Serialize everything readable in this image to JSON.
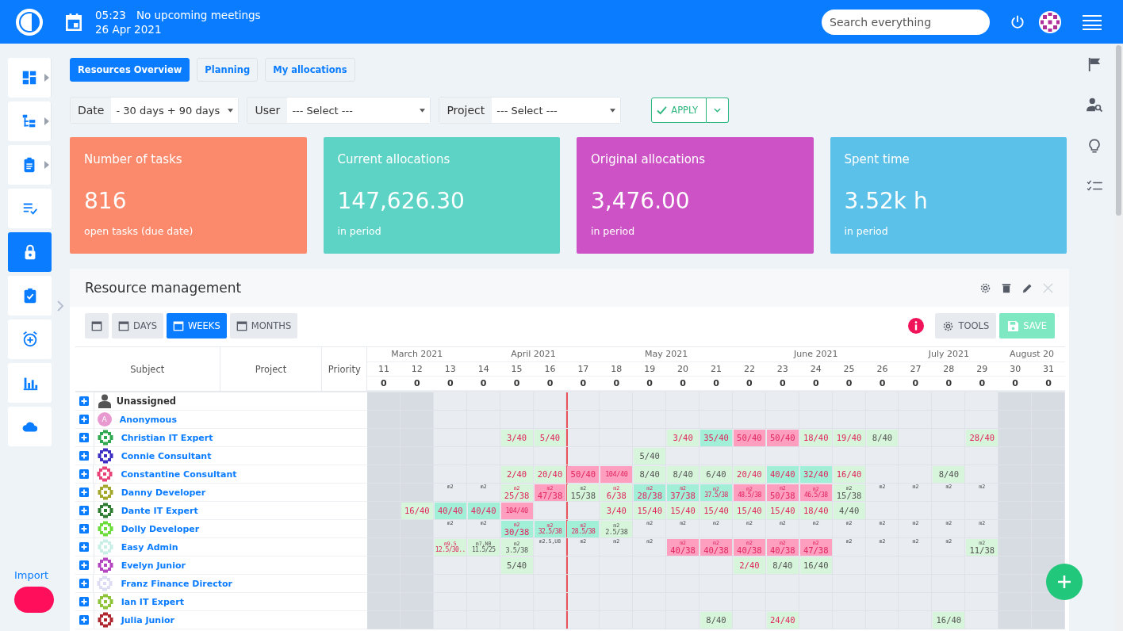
{
  "header": {
    "time": "05:23",
    "meetings": "No upcoming meetings",
    "date": "26 Apr 2021",
    "search": {
      "placeholder": "Search everything"
    }
  },
  "sidebar": {
    "items": [
      {
        "selected": false,
        "submenu": true
      },
      {
        "selected": false,
        "submenu": true
      },
      {
        "selected": false,
        "submenu": true
      },
      {
        "selected": false,
        "submenu": false
      },
      {
        "selected": true,
        "submenu": false
      },
      {
        "selected": false,
        "submenu": false
      },
      {
        "selected": false,
        "submenu": false
      },
      {
        "selected": false,
        "submenu": false
      },
      {
        "selected": false,
        "submenu": false
      }
    ],
    "import_label": "Import"
  },
  "tabs": [
    {
      "label": "Resources Overview",
      "selected": true
    },
    {
      "label": "Planning",
      "selected": false
    },
    {
      "label": "My allocations",
      "selected": false
    }
  ],
  "filters": [
    {
      "label": "Date",
      "value": "- 30 days + 90 days"
    },
    {
      "label": "User",
      "value": "--- Select ---"
    },
    {
      "label": "Project",
      "value": "--- Select ---"
    }
  ],
  "apply_button": "APPLY",
  "cards": [
    {
      "title": "Number of tasks",
      "value": "816",
      "caption": "open tasks (due date)",
      "color": "#fb8a6c"
    },
    {
      "title": "Current allocations",
      "value": "147,626.30",
      "caption": "in period",
      "color": "#5dd3c6"
    },
    {
      "title": "Original allocations",
      "value": "3,476.00",
      "caption": "in period",
      "color": "#cc52c6"
    },
    {
      "title": "Spent time",
      "value": "3.52k h",
      "caption": "in period",
      "color": "#5cc1e8"
    }
  ],
  "widget": {
    "title": "Resource management",
    "view_buttons": [
      {
        "label": "DAYS",
        "selected": false
      },
      {
        "label": "WEEKS",
        "selected": true
      },
      {
        "label": "MONTHS",
        "selected": false
      }
    ],
    "tools_button": "TOOLS",
    "save_button": "SAVE",
    "columns": [
      "Subject",
      "Project",
      "Priority"
    ],
    "months": [
      "March 2021",
      "April 2021",
      "May 2021",
      "June 2021",
      "July 2021",
      "August 20"
    ],
    "weeks": [
      {
        "label": "11",
        "count": "0",
        "shaded": true,
        "today": false
      },
      {
        "label": "12",
        "count": "0",
        "shaded": true,
        "today": false
      },
      {
        "label": "13",
        "count": "0",
        "shaded": false,
        "today": false
      },
      {
        "label": "14",
        "count": "0",
        "shaded": false,
        "today": false
      },
      {
        "label": "15",
        "count": "0",
        "shaded": false,
        "today": false
      },
      {
        "label": "16",
        "count": "0",
        "shaded": false,
        "today": false
      },
      {
        "label": "17",
        "count": "0",
        "shaded": false,
        "today": true
      },
      {
        "label": "18",
        "count": "0",
        "shaded": false,
        "today": false
      },
      {
        "label": "19",
        "count": "0",
        "shaded": false,
        "today": false
      },
      {
        "label": "20",
        "count": "0",
        "shaded": false,
        "today": false
      },
      {
        "label": "21",
        "count": "0",
        "shaded": false,
        "today": false
      },
      {
        "label": "22",
        "count": "0",
        "shaded": false,
        "today": false
      },
      {
        "label": "23",
        "count": "0",
        "shaded": false,
        "today": false
      },
      {
        "label": "24",
        "count": "0",
        "shaded": false,
        "today": false
      },
      {
        "label": "25",
        "count": "0",
        "shaded": false,
        "today": false
      },
      {
        "label": "26",
        "count": "0",
        "shaded": false,
        "today": false
      },
      {
        "label": "27",
        "count": "0",
        "shaded": false,
        "today": false
      },
      {
        "label": "28",
        "count": "0",
        "shaded": false,
        "today": false
      },
      {
        "label": "29",
        "count": "0",
        "shaded": false,
        "today": false
      },
      {
        "label": "30",
        "count": "0",
        "shaded": true,
        "today": false
      },
      {
        "label": "31",
        "count": "0",
        "shaded": true,
        "today": false
      }
    ],
    "rows": [
      {
        "name": "Unassigned",
        "kind": "group"
      },
      {
        "name": "Anonymous",
        "kind": "user",
        "initial": "A",
        "color": "#e89ad0"
      },
      {
        "name": "Christian IT Expert",
        "kind": "user",
        "color": "#2fa84f",
        "cells": [
          {
            "kind": "empty"
          },
          {
            "kind": "empty"
          },
          {
            "kind": "empty"
          },
          {
            "kind": "empty"
          },
          {
            "value": "3/40",
            "kind": "partial"
          },
          {
            "value": "5/40",
            "kind": "partial"
          },
          {
            "kind": "empty"
          },
          {
            "kind": "empty"
          },
          {
            "kind": "empty"
          },
          {
            "value": "3/40",
            "kind": "partial"
          },
          {
            "value": "35/40",
            "kind": "full"
          },
          {
            "value": "50/40",
            "kind": "over"
          },
          {
            "value": "50/40",
            "kind": "over"
          },
          {
            "value": "18/40",
            "kind": "partial"
          },
          {
            "value": "19/40",
            "kind": "partial"
          },
          {
            "value": "8/40",
            "kind": "low"
          },
          {
            "kind": "empty"
          },
          {
            "kind": "empty"
          },
          {
            "value": "28/40",
            "kind": "partial"
          },
          {
            "kind": "empty"
          },
          {
            "kind": "empty"
          }
        ]
      },
      {
        "name": "Connie Consultant",
        "kind": "user",
        "color": "#3d2fc4",
        "cells": [
          {
            "kind": "empty"
          },
          {
            "kind": "empty"
          },
          {
            "kind": "empty"
          },
          {
            "kind": "empty"
          },
          {
            "kind": "empty"
          },
          {
            "kind": "empty"
          },
          {
            "kind": "empty"
          },
          {
            "kind": "empty"
          },
          {
            "value": "5/40",
            "kind": "low"
          },
          {
            "kind": "empty"
          },
          {
            "kind": "empty"
          },
          {
            "kind": "empty"
          },
          {
            "kind": "empty"
          },
          {
            "kind": "empty"
          },
          {
            "kind": "empty"
          },
          {
            "kind": "empty"
          },
          {
            "kind": "empty"
          },
          {
            "kind": "empty"
          },
          {
            "kind": "empty"
          },
          {
            "kind": "empty"
          },
          {
            "kind": "empty"
          }
        ]
      },
      {
        "name": "Constantine Consultant",
        "kind": "user",
        "color": "#e8447a",
        "cells": [
          {
            "kind": "empty"
          },
          {
            "kind": "empty"
          },
          {
            "kind": "empty"
          },
          {
            "kind": "empty"
          },
          {
            "value": "2/40",
            "kind": "partial"
          },
          {
            "value": "20/40",
            "kind": "partial"
          },
          {
            "value": "50/40",
            "kind": "over"
          },
          {
            "value": "104/40",
            "kind": "over"
          },
          {
            "value": "8/40",
            "kind": "low"
          },
          {
            "value": "8/40",
            "kind": "low"
          },
          {
            "value": "6/40",
            "kind": "low"
          },
          {
            "value": "20/40",
            "kind": "partial"
          },
          {
            "value": "40/40",
            "kind": "full"
          },
          {
            "value": "32/40",
            "kind": "full"
          },
          {
            "value": "16/40",
            "kind": "partial"
          },
          {
            "kind": "empty"
          },
          {
            "kind": "empty"
          },
          {
            "value": "8/40",
            "kind": "low"
          },
          {
            "kind": "empty"
          },
          {
            "kind": "empty"
          },
          {
            "kind": "empty"
          }
        ]
      },
      {
        "name": "Danny Developer",
        "kind": "user",
        "color": "#a3a82c",
        "cells": [
          {
            "kind": "empty"
          },
          {
            "kind": "empty"
          },
          {
            "note": "m2",
            "kind": "plain"
          },
          {
            "note": "m2",
            "kind": "plain"
          },
          {
            "note": "m2",
            "value": "25/38",
            "kind": "partial"
          },
          {
            "note": "m2",
            "value": "47/38",
            "kind": "over"
          },
          {
            "note": "m2",
            "value": "15/38",
            "kind": "low"
          },
          {
            "note": "m2",
            "value": "6/38",
            "kind": "partial"
          },
          {
            "note": "m2",
            "value": "28/38",
            "kind": "full"
          },
          {
            "note": "m2",
            "value": "37/38",
            "kind": "full"
          },
          {
            "note": "m2",
            "value": "37.5/38",
            "kind": "full"
          },
          {
            "note": "m2",
            "value": "48.5/38",
            "kind": "over"
          },
          {
            "note": "m2",
            "value": "50/38",
            "kind": "over"
          },
          {
            "note": "m2",
            "value": "46.5/38",
            "kind": "over"
          },
          {
            "note": "m2",
            "value": "15/38",
            "kind": "low"
          },
          {
            "note": "m2",
            "kind": "plain"
          },
          {
            "note": "m2",
            "kind": "plain"
          },
          {
            "note": "m2",
            "kind": "plain"
          },
          {
            "note": "m2",
            "kind": "plain"
          },
          {
            "kind": "empty"
          },
          {
            "kind": "empty"
          }
        ]
      },
      {
        "name": "Dante IT Expert",
        "kind": "user",
        "color": "#2e7d32",
        "cells": [
          {
            "kind": "empty"
          },
          {
            "value": "16/40",
            "kind": "partial"
          },
          {
            "value": "40/40",
            "kind": "full"
          },
          {
            "value": "40/40",
            "kind": "full"
          },
          {
            "value": "104/40",
            "kind": "over"
          },
          {
            "kind": "empty"
          },
          {
            "kind": "empty"
          },
          {
            "value": "3/40",
            "kind": "partial"
          },
          {
            "value": "15/40",
            "kind": "partial"
          },
          {
            "value": "15/40",
            "kind": "partial"
          },
          {
            "value": "15/40",
            "kind": "partial"
          },
          {
            "value": "15/40",
            "kind": "partial"
          },
          {
            "value": "15/40",
            "kind": "partial"
          },
          {
            "value": "18/40",
            "kind": "partial"
          },
          {
            "value": "4/40",
            "kind": "low"
          },
          {
            "kind": "empty"
          },
          {
            "kind": "empty"
          },
          {
            "kind": "empty"
          },
          {
            "kind": "empty"
          },
          {
            "kind": "empty"
          },
          {
            "kind": "empty"
          }
        ]
      },
      {
        "name": "Dolly Developer",
        "kind": "user",
        "color": "#6bdc3a",
        "cells": [
          {
            "kind": "empty"
          },
          {
            "kind": "empty"
          },
          {
            "note": "m2",
            "kind": "plain"
          },
          {
            "note": "m2",
            "kind": "plain"
          },
          {
            "note": "m2",
            "value": "30/38",
            "kind": "full"
          },
          {
            "note": "m2",
            "value": "32.5/38",
            "kind": "full"
          },
          {
            "note": "m2",
            "value": "28.5/38",
            "kind": "full"
          },
          {
            "note": "m2",
            "value": "2.5/38",
            "kind": "low"
          },
          {
            "note": "m2",
            "kind": "plain"
          },
          {
            "note": "m2",
            "kind": "plain"
          },
          {
            "note": "m2",
            "kind": "plain"
          },
          {
            "note": "m2",
            "kind": "plain"
          },
          {
            "note": "m2",
            "kind": "plain"
          },
          {
            "note": "m2",
            "kind": "plain"
          },
          {
            "note": "m2",
            "kind": "plain"
          },
          {
            "note": "m2",
            "kind": "plain"
          },
          {
            "note": "m2",
            "kind": "plain"
          },
          {
            "note": "m2",
            "kind": "plain"
          },
          {
            "note": "m2",
            "kind": "plain"
          },
          {
            "kind": "empty"
          },
          {
            "kind": "empty"
          }
        ]
      },
      {
        "name": "Easy Admin",
        "kind": "user",
        "color": "#c8efe6",
        "cells": [
          {
            "kind": "empty"
          },
          {
            "kind": "empty"
          },
          {
            "note": "m9.5",
            "value": "12.5/30..",
            "kind": "partial"
          },
          {
            "note": "m7,NB",
            "value": "11.5/25",
            "kind": "low"
          },
          {
            "note": "m2",
            "value": "3.5/38",
            "kind": "low"
          },
          {
            "note": "m2.5,U8",
            "kind": "plain"
          },
          {
            "note": "m2",
            "kind": "plain"
          },
          {
            "note": "m2",
            "kind": "plain"
          },
          {
            "note": "m2",
            "kind": "plain"
          },
          {
            "note": "m2",
            "value": "40/38",
            "kind": "over"
          },
          {
            "note": "m2",
            "value": "40/38",
            "kind": "over"
          },
          {
            "note": "m2",
            "value": "40/38",
            "kind": "over"
          },
          {
            "note": "m2",
            "value": "40/38",
            "kind": "over"
          },
          {
            "note": "m2",
            "value": "47/38",
            "kind": "over"
          },
          {
            "note": "m2",
            "kind": "plain"
          },
          {
            "note": "m2",
            "kind": "plain"
          },
          {
            "note": "m2",
            "kind": "plain"
          },
          {
            "note": "m2",
            "kind": "plain"
          },
          {
            "note": "m2",
            "value": "11/38",
            "kind": "low"
          },
          {
            "kind": "empty"
          },
          {
            "kind": "empty"
          }
        ]
      },
      {
        "name": "Evelyn Junior",
        "kind": "user",
        "color": "#b545c0",
        "cells": [
          {
            "kind": "empty"
          },
          {
            "kind": "empty"
          },
          {
            "kind": "empty"
          },
          {
            "kind": "empty"
          },
          {
            "value": "5/40",
            "kind": "low"
          },
          {
            "kind": "empty"
          },
          {
            "kind": "empty"
          },
          {
            "kind": "empty"
          },
          {
            "kind": "empty"
          },
          {
            "kind": "empty"
          },
          {
            "kind": "empty"
          },
          {
            "value": "2/40",
            "kind": "partial"
          },
          {
            "value": "8/40",
            "kind": "low"
          },
          {
            "value": "16/40",
            "kind": "low"
          },
          {
            "kind": "empty"
          },
          {
            "kind": "empty"
          },
          {
            "kind": "empty"
          },
          {
            "kind": "empty"
          },
          {
            "kind": "empty"
          },
          {
            "kind": "empty"
          },
          {
            "kind": "empty"
          }
        ]
      },
      {
        "name": "Franz Finance Director",
        "kind": "user",
        "color": "#dcdcf4"
      },
      {
        "name": "Ian IT Expert",
        "kind": "user",
        "color": "#8fc43a"
      },
      {
        "name": "Julia Junior",
        "kind": "user",
        "color": "#b0262e",
        "cells": [
          {
            "kind": "empty"
          },
          {
            "kind": "empty"
          },
          {
            "kind": "empty"
          },
          {
            "kind": "empty"
          },
          {
            "kind": "empty"
          },
          {
            "kind": "empty"
          },
          {
            "kind": "empty"
          },
          {
            "kind": "empty"
          },
          {
            "kind": "empty"
          },
          {
            "kind": "empty"
          },
          {
            "value": "8/40",
            "kind": "low"
          },
          {
            "kind": "empty"
          },
          {
            "value": "24/40",
            "kind": "partial"
          },
          {
            "kind": "empty"
          },
          {
            "kind": "empty"
          },
          {
            "kind": "empty"
          },
          {
            "kind": "empty"
          },
          {
            "value": "16/40",
            "kind": "low"
          },
          {
            "kind": "empty"
          },
          {
            "kind": "empty"
          },
          {
            "kind": "empty"
          }
        ]
      }
    ]
  }
}
